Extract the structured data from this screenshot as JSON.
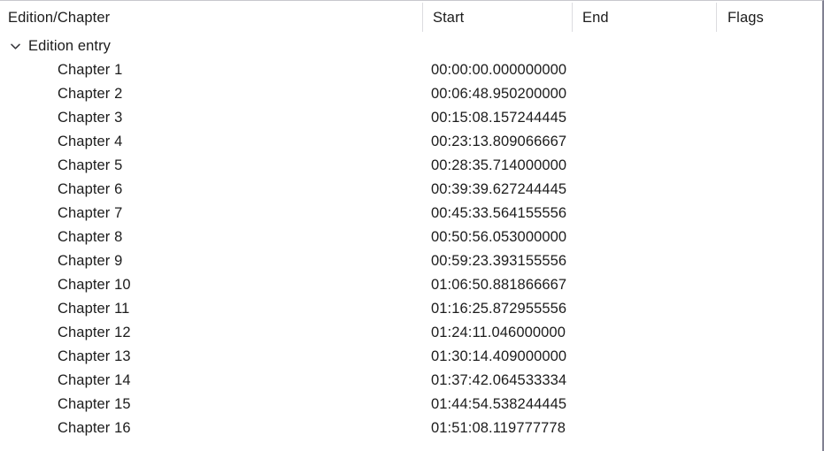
{
  "view": {
    "name": "chapter-editor-tree",
    "accent_text_color": "#1c1c1c",
    "separator_color": "#dcdce0",
    "border_color": "#808091"
  },
  "header": {
    "columns": [
      {
        "key": "edition_chapter",
        "label": "Edition/Chapter"
      },
      {
        "key": "start",
        "label": "Start"
      },
      {
        "key": "end",
        "label": "End"
      },
      {
        "key": "flags",
        "label": "Flags"
      }
    ]
  },
  "tree": {
    "root": {
      "label": "Edition entry",
      "expanded": true,
      "twisty_icon": "chevron-down-icon",
      "start": "",
      "end": "",
      "flags": ""
    },
    "children": [
      {
        "label": "Chapter 1",
        "start": "00:00:00.000000000",
        "end": "",
        "flags": ""
      },
      {
        "label": "Chapter 2",
        "start": "00:06:48.950200000",
        "end": "",
        "flags": ""
      },
      {
        "label": "Chapter 3",
        "start": "00:15:08.157244445",
        "end": "",
        "flags": ""
      },
      {
        "label": "Chapter 4",
        "start": "00:23:13.809066667",
        "end": "",
        "flags": ""
      },
      {
        "label": "Chapter 5",
        "start": "00:28:35.714000000",
        "end": "",
        "flags": ""
      },
      {
        "label": "Chapter 6",
        "start": "00:39:39.627244445",
        "end": "",
        "flags": ""
      },
      {
        "label": "Chapter 7",
        "start": "00:45:33.564155556",
        "end": "",
        "flags": ""
      },
      {
        "label": "Chapter 8",
        "start": "00:50:56.053000000",
        "end": "",
        "flags": ""
      },
      {
        "label": "Chapter 9",
        "start": "00:59:23.393155556",
        "end": "",
        "flags": ""
      },
      {
        "label": "Chapter 10",
        "start": "01:06:50.881866667",
        "end": "",
        "flags": ""
      },
      {
        "label": "Chapter 11",
        "start": "01:16:25.872955556",
        "end": "",
        "flags": ""
      },
      {
        "label": "Chapter 12",
        "start": "01:24:11.046000000",
        "end": "",
        "flags": ""
      },
      {
        "label": "Chapter 13",
        "start": "01:30:14.409000000",
        "end": "",
        "flags": ""
      },
      {
        "label": "Chapter 14",
        "start": "01:37:42.064533334",
        "end": "",
        "flags": ""
      },
      {
        "label": "Chapter 15",
        "start": "01:44:54.538244445",
        "end": "",
        "flags": ""
      },
      {
        "label": "Chapter 16",
        "start": "01:51:08.119777778",
        "end": "",
        "flags": ""
      }
    ]
  }
}
